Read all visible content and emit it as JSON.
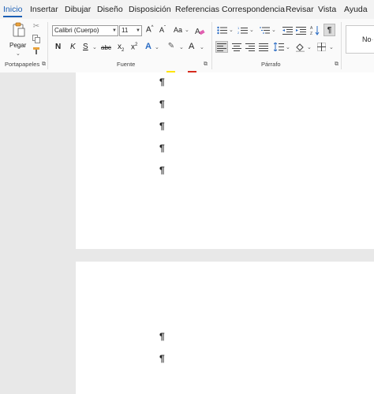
{
  "tabs": [
    {
      "label": "Inicio"
    },
    {
      "label": "Insertar"
    },
    {
      "label": "Dibujar"
    },
    {
      "label": "Diseño"
    },
    {
      "label": "Disposición"
    },
    {
      "label": "Referencias"
    },
    {
      "label": "Correspondencia"
    },
    {
      "label": "Revisar"
    },
    {
      "label": "Vista"
    },
    {
      "label": "Ayuda"
    }
  ],
  "clipboard": {
    "group_label": "Portapapeles",
    "paste_label": "Pegar",
    "icons": [
      "clipboard-icon",
      "scissors-icon",
      "copy-icon",
      "format-painter-icon"
    ]
  },
  "font": {
    "group_label": "Fuente",
    "font_name": "Calibri (Cuerpo)",
    "font_size": "11",
    "grow_label": "A",
    "shrink_label": "A",
    "case_label": "Aa",
    "bold_label": "N",
    "italic_label": "K",
    "underline_label": "S",
    "strike_label": "abc",
    "subscript_label": "x",
    "superscript_label": "x",
    "effects_label": "A",
    "highlight_label": "A",
    "fontcolor_label": "A",
    "highlight_color": "#ffe400",
    "fontcolor_color": "#d62b1e"
  },
  "paragraph": {
    "group_label": "Párrafo"
  },
  "styles": {
    "preview_label": "No"
  },
  "document": {
    "pilcrow": "¶"
  },
  "colors": {
    "accent": "#1b5fb5"
  }
}
